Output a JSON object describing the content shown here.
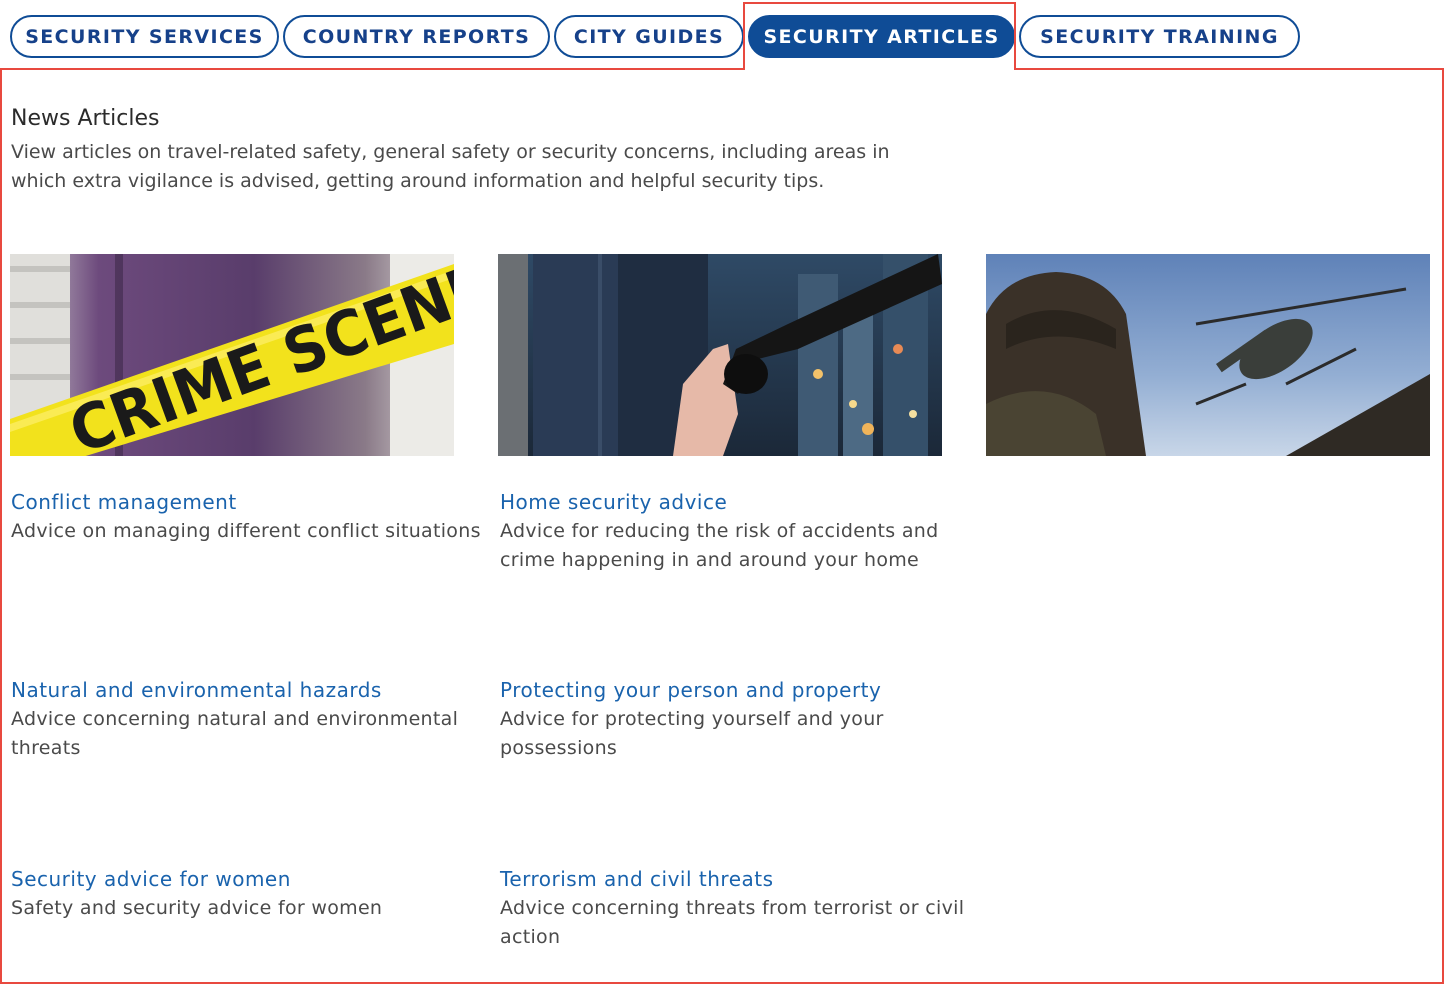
{
  "tabs": [
    {
      "label": "Security Services"
    },
    {
      "label": "Country Reports"
    },
    {
      "label": "City Guides"
    },
    {
      "label": "Security Articles"
    },
    {
      "label": "Security Training"
    }
  ],
  "active_tab": "Security Articles",
  "intro": {
    "title": "News Articles",
    "description": "View articles on travel-related safety, general safety or security concerns, including areas in which extra vigilance is advised, getting around information and helpful security tips."
  },
  "images": {
    "crime_scene_tape_text": "CRIME SCENE"
  },
  "articles": [
    {
      "title": "Conflict management",
      "description": "Advice on managing different conflict situations"
    },
    {
      "title": "Home security advice",
      "description": "Advice for reducing the risk of accidents and crime happening in and around your home"
    },
    {
      "title": "Natural and environmental hazards",
      "description": "Advice concerning natural and environmental threats"
    },
    {
      "title": "Protecting your person and property",
      "description": "Advice for protecting yourself and your possessions"
    },
    {
      "title": "Security advice for women",
      "description": "Safety and security advice for women"
    },
    {
      "title": "Terrorism and civil threats",
      "description": "Advice concerning threats from terrorist or civil action"
    }
  ],
  "colors": {
    "tab_border": "#0f4c96",
    "tab_text": "#16418a",
    "active_tab_bg": "#0f4c96",
    "link": "#1a63ad",
    "highlight_outline": "#e8493f"
  }
}
